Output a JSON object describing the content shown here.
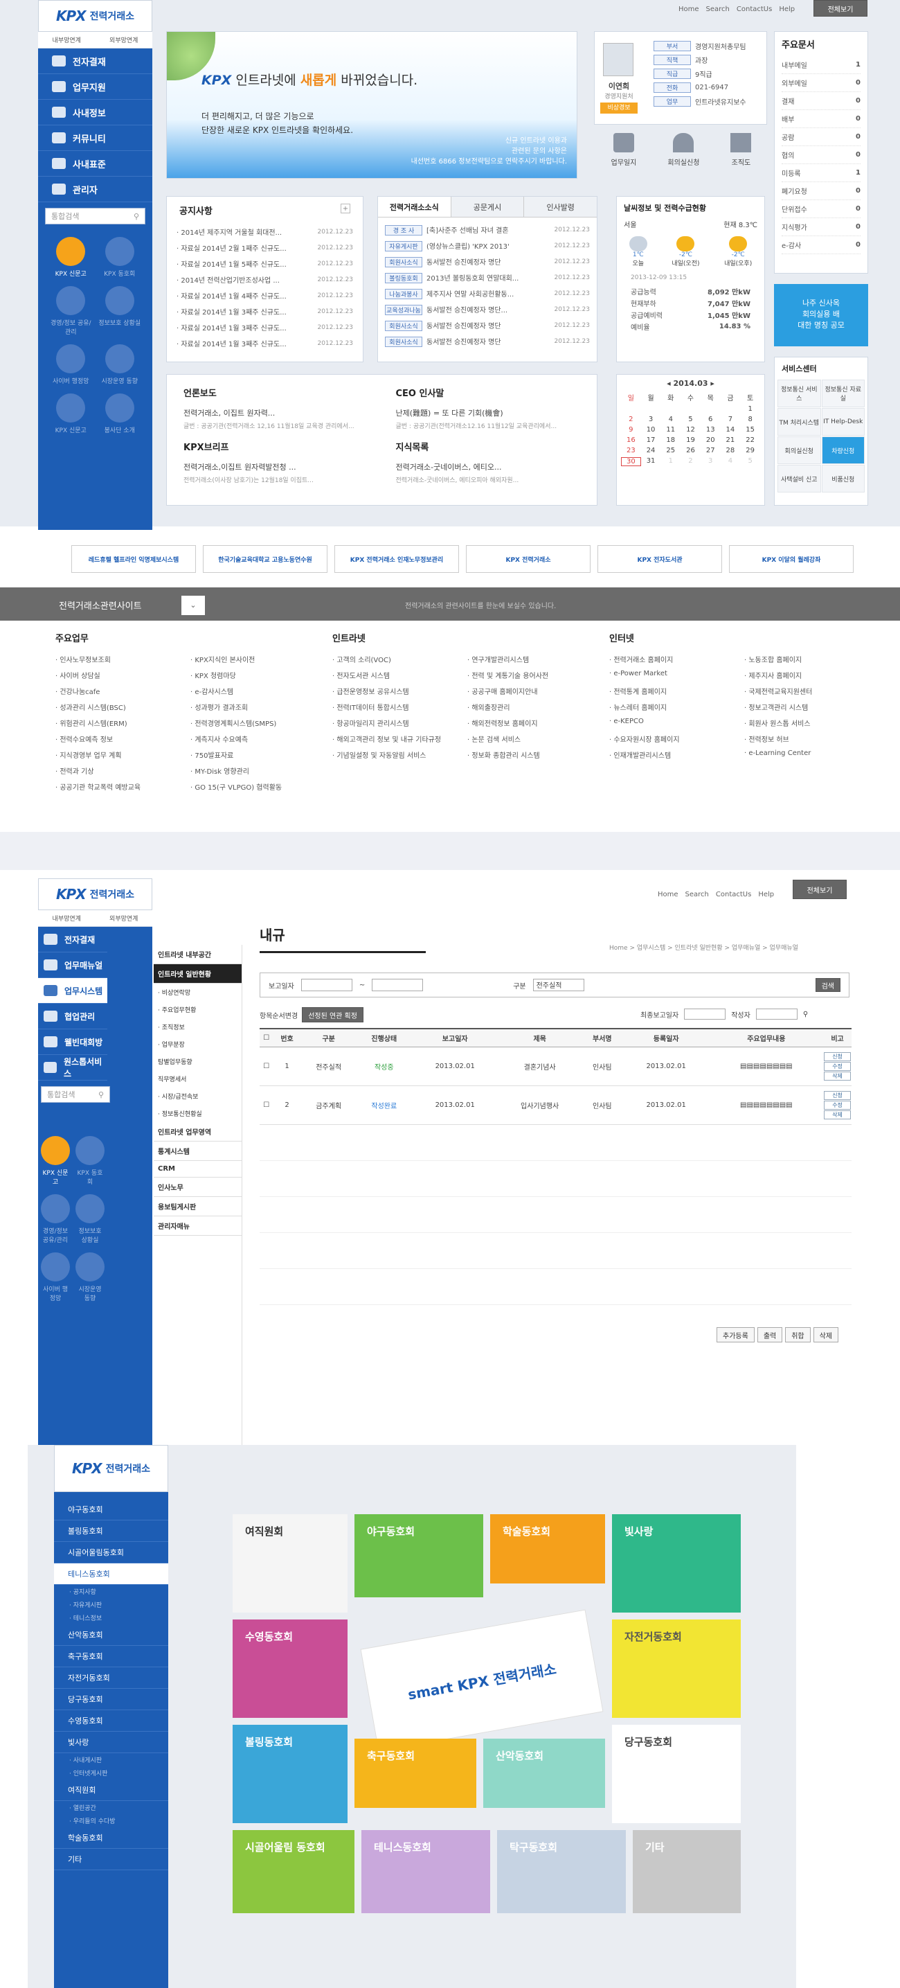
{
  "top": {
    "links": [
      "Home",
      "Search",
      "ContactUs",
      "Help"
    ],
    "all_view": "전체보기",
    "logo_text": "전력거래소",
    "logo_kpx": "KPX",
    "small_links": [
      "내부망연계",
      "외부망연계"
    ],
    "nav": [
      "전자결재",
      "업무지원",
      "사내정보",
      "커뮤니티",
      "사내표준",
      "관리자"
    ],
    "search_placeholder": "통합검색",
    "circles": [
      "KPX 신문고",
      "KPX 동호회",
      "경영/정보 공유/관리",
      "정보보호 상황실",
      "사이버 행정망",
      "시장운영 동향",
      "KPX 신문고",
      "봉사단 소개"
    ],
    "banner": {
      "kpx": "KPX",
      "title_a": "인트라넷에 ",
      "title_hi": "새롭게",
      "title_b": " 바뀌었습니다.",
      "line1": "더 편리해지고, 더 많은 기능으로",
      "line2": "단장한 새로운 KPX 인트라넷을 확인하세요.",
      "note1": "신규 인트라넷 이용과",
      "note2": "관련된 문의 사항은",
      "note3": "내선번호 6866 정보전략팀으로 연락주시기 바랍니다."
    },
    "profile": {
      "name": "이연희",
      "dept": "경영지원처",
      "role": "비상경보",
      "labels": [
        "부서",
        "직책",
        "직급",
        "전화",
        "업무"
      ],
      "values": [
        "경영지원처총무팀",
        "과장",
        "9직급",
        "021-6947",
        "인트라넷유지보수"
      ]
    },
    "quick": [
      "업무일지",
      "회의실신청",
      "조직도"
    ],
    "docs": {
      "title": "주요문서",
      "items": [
        [
          "내부메일",
          "1"
        ],
        [
          "외부메일",
          "0"
        ],
        [
          "결재",
          "0"
        ],
        [
          "배부",
          "0"
        ],
        [
          "공람",
          "0"
        ],
        [
          "협의",
          "0"
        ],
        [
          "미등록",
          "1"
        ],
        [
          "폐기요청",
          "0"
        ],
        [
          "단위접수",
          "0"
        ],
        [
          "지식평가",
          "0"
        ],
        [
          "e-감사",
          "0"
        ]
      ]
    },
    "notice": {
      "title": "공지사항",
      "items": [
        [
          "2014년 제주지역 거울철 회대전...",
          "2012.12.23"
        ],
        [
          "자료실 2014년 2월 1째주 신규도...",
          "2012.12.23"
        ],
        [
          "자료실 2014년 1월 5째주 신규도...",
          "2012.12.23"
        ],
        [
          "2014년 전력산업기반조성사업 ...",
          "2012.12.23"
        ],
        [
          "자료실 2014년 1월 4째주 신규도...",
          "2012.12.23"
        ],
        [
          "자료실 2014년 1월 3째주 신규도...",
          "2012.12.23"
        ],
        [
          "자료실 2014년 1월 3째주 신규도...",
          "2012.12.23"
        ],
        [
          "자료실 2014년 1월 3째주 신규도...",
          "2012.12.23"
        ]
      ]
    },
    "tabs": [
      "전력거래소소식",
      "공문게시",
      "인사발령"
    ],
    "news": [
      [
        "경 조 사",
        "[축]사준주 선배님 자녀 결혼",
        "2012.12.23"
      ],
      [
        "자유게시판",
        "(영상뉴스클립) 'KPX 2013'",
        "2012.12.23"
      ],
      [
        "회원사소식",
        "동서발전 승진예정자 명단",
        "2012.12.23"
      ],
      [
        "볼링동호회",
        "2013년 볼링동호회 연말대회...",
        "2012.12.23"
      ],
      [
        "나눔과봉사",
        "제주지사 연말 사회공헌활동...",
        "2012.12.23"
      ],
      [
        "교육성과나눔",
        "동서발전 승진예정자 명단...",
        "2012.12.23"
      ],
      [
        "회원사소식",
        "동서발전 승진예정자 명단",
        "2012.12.23"
      ],
      [
        "회원사소식",
        "동서발전 승진예정자 명단",
        "2012.12.23"
      ]
    ],
    "weather": {
      "title": "날씨정보 및 전력수급현황",
      "city": "서울",
      "now": "현재 8.3℃",
      "days": [
        [
          "1℃",
          "오늘"
        ],
        [
          "-2℃",
          "내일(오전)"
        ],
        [
          "-2℃",
          "내일(오후)"
        ]
      ],
      "time": "2013-12-09 13:15",
      "rows": [
        [
          "공급능력",
          "8,092",
          "만kW"
        ],
        [
          "현재부하",
          "7,047",
          "만kW"
        ],
        [
          "공급예비력",
          "1,045",
          "만kW"
        ],
        [
          "예비율",
          "14.83",
          "%"
        ]
      ]
    },
    "press": [
      {
        "title": "언론보도",
        "head": "전력거래소, 이집트 원자력...",
        "body": "글번 : 공공기관(전력거래소 12,16 11월18일 교육경 관리에서..."
      },
      {
        "title": "CEO 인사말",
        "head": "난제(難題) = 또 다른 기회(機會)",
        "body": "글번 : 공공기관(전력거래소12.16 11월12일 교육관리에서..."
      },
      {
        "title": "KPX브리프",
        "head": "전력거래소,이집트 원자력발전청 ...",
        "body": "전력거래소(이사장 남호기)는 12월18일 이집트..."
      },
      {
        "title": "지식목록",
        "head": "전력거래소-굿네이버스, 에티오...",
        "body": "전력거래소-굿네이버스, 에티오피아 해외자원..."
      }
    ],
    "calendar": {
      "title": "2014.03",
      "week": [
        "일",
        "월",
        "화",
        "수",
        "목",
        "금",
        "토"
      ],
      "days": [
        "",
        "",
        "",
        "",
        "",
        "",
        1,
        2,
        3,
        4,
        5,
        6,
        7,
        8,
        9,
        10,
        11,
        12,
        13,
        14,
        15,
        16,
        17,
        18,
        19,
        20,
        21,
        22,
        23,
        24,
        25,
        26,
        27,
        28,
        29,
        30,
        31,
        1,
        2,
        3,
        4,
        5
      ]
    },
    "service": {
      "title": "서비스센터",
      "items": [
        "정보통신 서비스",
        "정보통신 자료실",
        "TM 처리시스템",
        "IT Help-Desk",
        "회의실신청",
        "차량신청",
        "사택설비 신고",
        "비품신청"
      ]
    },
    "ad": {
      "l1": "나주 신사옥",
      "l2": "회의실용 배",
      "l3": "대한 명칭 공모"
    }
  },
  "banners": [
    "레드휴렐 헬프라인 익명제보시스템",
    "한국기술교육대학교 고용노동연수원",
    "KPX 전력거래소 인재노무정보관리",
    "KPX 전력거래소",
    "KPX 전자도서관",
    "KPX 이달의 월례강좌"
  ],
  "related": {
    "title": "전력거래소관련사이트",
    "desc": "전력거래소의 관련사이트를 한눈에 보실수 있습니다.",
    "cols": [
      {
        "h": "주요업무",
        "a": [
          "인사노무정보조회",
          "사이버 상담실",
          "건강나눔cafe",
          "성과관리 시스템(BSC)",
          "위험관리 시스템(ERM)",
          "전력수요예측 정보",
          "지식경영부 업무 계획",
          "전력과 기상",
          "공공기관 학교폭력 예방교육"
        ],
        "b": [
          "KPX지식인 본사이전",
          "KPX 청렴마당",
          "e-감사시스템",
          "성과평가 결과조회",
          "전력경영계획시스템(SMPS)",
          "계측지사 수요예측",
          "750발표자료",
          "MY-Disk 영향관리",
          "GO 15(구 VLPGO) 협력활동"
        ]
      },
      {
        "h": "인트라넷",
        "a": [
          "고객의 소리(VOC)",
          "전자도서관 시스템",
          "급전운영정보 공유시스템",
          "전력IT데이터 통합시스템",
          "항공마일리지 관리시스템",
          "해외고객관리 정보 및 내규 기타규정",
          "기념일설정 및 자동알림 서비스"
        ],
        "b": [
          "연구개발관리시스템",
          "전력 및 계통기술 용어사전",
          "공공구매 홈페이지안내",
          "해외출장관리",
          "해외전력정보 홈페이지",
          "논문 검색 서비스",
          "정보화 종합관리 시스템"
        ]
      },
      {
        "h": "인터넷",
        "a": [
          "전력거래소 홈페이지",
          "e-Power Market",
          "전력통계 홈페이지",
          "뉴스레터 홈페이지",
          "e-KEPCO",
          "수요자원시장 홈페이지",
          "인재개발관리시스템"
        ],
        "b": [
          "노동조합 홈페이지",
          "제주지사 홈페이지",
          "국제전력교육지원센터",
          "정보고객관리 시스템",
          "회원사 원스톱 서비스",
          "전력정보 허브",
          "e-Learning Center"
        ]
      }
    ]
  },
  "sub": {
    "title": "내규",
    "nav": [
      "전자결재",
      "업무매뉴얼",
      "업무시스템",
      "협업관리",
      "웰빈대회방",
      "원스톱서비스"
    ],
    "menu": [
      "인트라넷 내부공간",
      "인트라넷 일반현황",
      "· 비상연락망",
      "· 주요업무현황",
      "· 조직정보",
      "· 업무분장",
      "탐별업무동향",
      "직무명세서",
      "· 시장/급전속보",
      "· 정보통신현황실",
      "인트라넷 업무영역",
      "통계시스템",
      "CRM",
      "인사노무",
      "용보팀게시판",
      "관리자매뉴"
    ],
    "breadcrumb": "Home  >  업무시스템  >  인트라넷 일반현황  >  업무매뉴얼  >  업무매뉴얼",
    "filter": {
      "date_label": "보고일자",
      "type_label": "구분",
      "type_value": "전주실적",
      "search": "검색",
      "sort": "항목순서변경",
      "sort_btn": "선정된 연관 획정",
      "recent": "최종보고일자",
      "writer": "작성자"
    },
    "cols": [
      "번호",
      "구분",
      "진행상태",
      "보고일자",
      "제목",
      "부서명",
      "등록일자",
      "주요업무내용",
      "비고"
    ],
    "rows": [
      [
        "1",
        "전주실적",
        "작성중",
        "2013.02.01",
        "결혼기념사",
        "인사팀",
        "2013.02.01"
      ],
      [
        "2",
        "금주계획",
        "작성완료",
        "2013.02.01",
        "입사기념행사",
        "인사팀",
        "2013.02.01"
      ]
    ],
    "row_btns": [
      "신청",
      "수정",
      "삭제"
    ],
    "actions": [
      "추가등록",
      "출력",
      "취합",
      "삭제"
    ]
  },
  "club": {
    "menu": [
      "야구동호회",
      "볼링동호회",
      "시골어울림동호회",
      "테니스동호회",
      "· 공지사항",
      "· 자유게시판",
      "· 테니스정보",
      "산악동호회",
      "축구동호회",
      "자전거동호회",
      "당구동호회",
      "수영동호회",
      "빛사랑",
      "· 사내게시판",
      "· 인터넷게시판",
      "여직원회",
      "· 열린공간",
      "· 우리들의 수다방",
      "학술동호회",
      "기타"
    ],
    "tiles": [
      "여직원회",
      "야구동호회",
      "학술동호회",
      "빛사랑",
      "수영동호회",
      "자전거동호회",
      "볼링동호회",
      "축구동호회",
      "산악동호회",
      "당구동호회",
      "시골어울림 동호회",
      "테니스동호회",
      "탁구동호회",
      "기타"
    ],
    "center": "smart KPX 전력거래소"
  }
}
